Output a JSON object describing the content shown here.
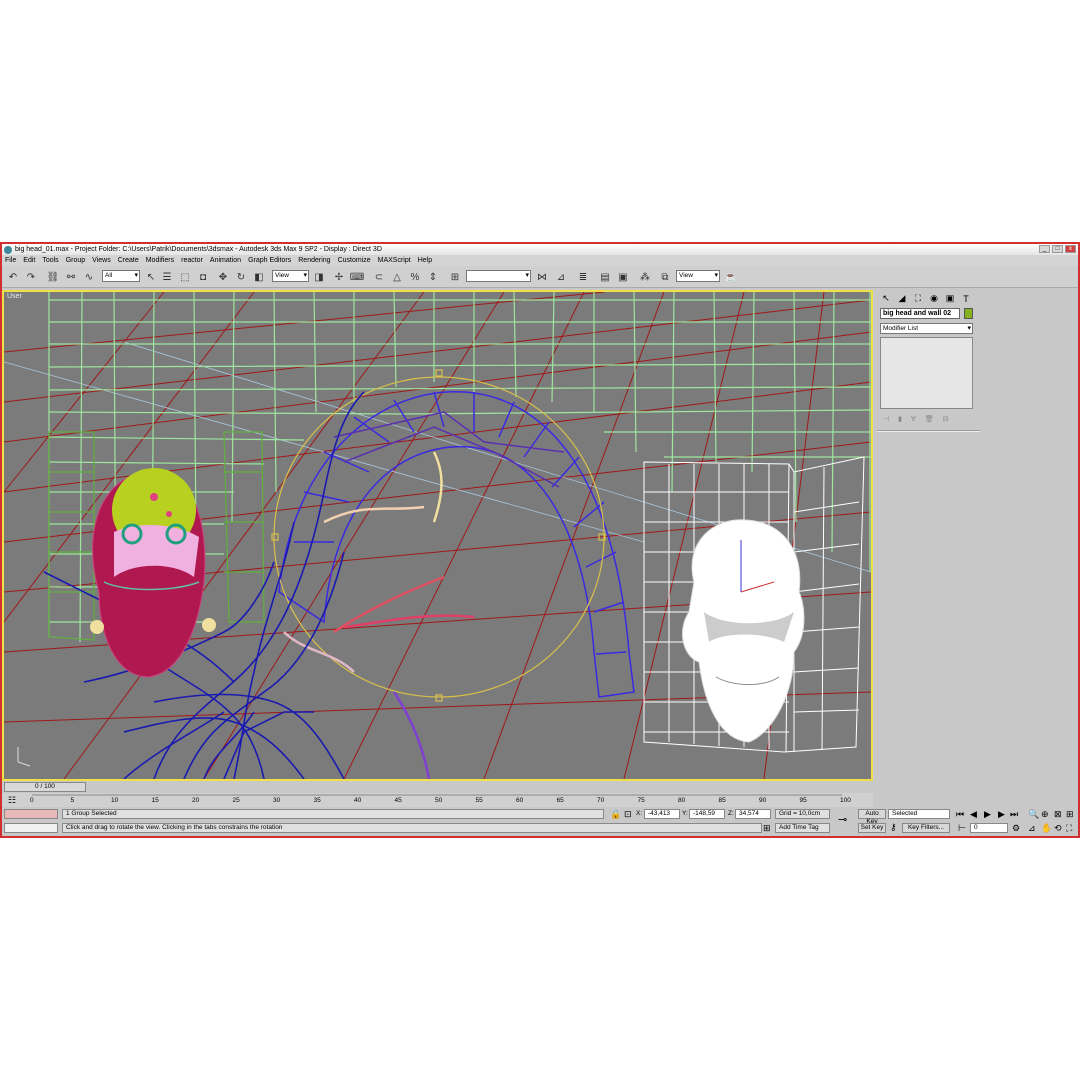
{
  "window": {
    "title": "big head_01.max    - Project Folder: C:\\Users\\Patrik\\Documents\\3dsmax    - Autodesk 3ds Max 9 SP2    - Display : Direct 3D"
  },
  "menu": [
    "File",
    "Edit",
    "Tools",
    "Group",
    "Views",
    "Create",
    "Modifiers",
    "reactor",
    "Animation",
    "Graph Editors",
    "Rendering",
    "Customize",
    "MAXScript",
    "Help"
  ],
  "toolbar": {
    "selection_filter": "All",
    "ref_coord": "View",
    "named_selection": "",
    "render_view": "View"
  },
  "viewport": {
    "label": "User"
  },
  "command_panel": {
    "object_name": "big head and wall 02",
    "object_color": "#86b020",
    "modifier_list": "Modifier List"
  },
  "time": {
    "slider": "0 / 100",
    "ticks": [
      "0",
      "5",
      "10",
      "15",
      "20",
      "25",
      "30",
      "35",
      "40",
      "45",
      "50",
      "55",
      "60",
      "65",
      "70",
      "75",
      "80",
      "85",
      "90",
      "95",
      "100"
    ]
  },
  "status": {
    "selection": "1 Group Selected",
    "prompt": "Click and drag to rotate the view.  Clicking in the tabs constrains the rotation",
    "x_label": "X:",
    "x": "-43,413",
    "y_label": "Y:",
    "y": "-148,59",
    "z_label": "Z:",
    "z": "34,574",
    "grid": "Grid = 10,0cm",
    "add_time_tag": "Add Time Tag"
  },
  "anim": {
    "auto_key": "Auto Key",
    "set_key": "Set Key",
    "selected": "Selected",
    "key_filters": "Key Filters...",
    "frame": "0"
  }
}
